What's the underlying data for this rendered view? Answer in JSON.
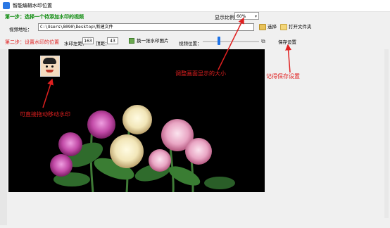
{
  "window": {
    "title": "智能编辑水印位置"
  },
  "step1": {
    "label": "第一步：选择一个待添加水印的视频"
  },
  "display_ratio": {
    "label": "显示比例：",
    "value": "60%"
  },
  "video_path": {
    "label": "视频地址：",
    "value": "C:\\Users\\8090\\Desktop\\新建文件"
  },
  "buttons": {
    "select": "选择",
    "open_folder": "打开文件夹",
    "swap_watermark": "换一张水印图片",
    "save_settings": "保存设置"
  },
  "step2": {
    "label": "第二步：设置水印的位置",
    "watermark_left_label": "水印左距：",
    "watermark_left_value": "163",
    "top_label": "顶距：",
    "top_value": "43",
    "video_position_label": "视频位置："
  },
  "annotations": {
    "adjust_size": "调整画面显示的大小",
    "remember_save": "记得保存设置",
    "drag_watermark": "可直接拖动移动水印"
  },
  "colors": {
    "step1": "#0a8a0a",
    "step2": "#e02020",
    "annotation": "#e02020",
    "slider": "#1e73e8"
  },
  "icons": [
    "app-icon",
    "folder-icon",
    "image-icon",
    "slider-icon"
  ]
}
